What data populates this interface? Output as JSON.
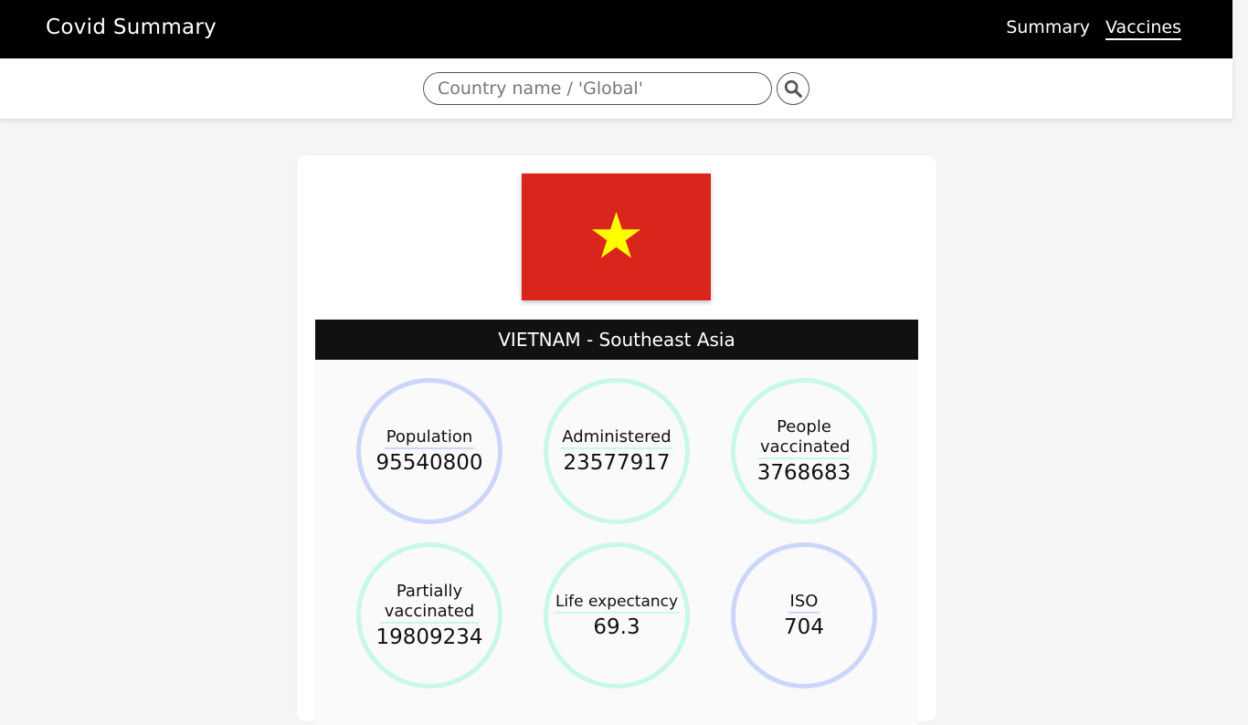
{
  "header": {
    "brand": "Covid Summary",
    "nav": [
      {
        "label": "Summary",
        "active": false
      },
      {
        "label": "Vaccines",
        "active": true
      }
    ]
  },
  "search": {
    "placeholder": "Country name / 'Global'",
    "value": "",
    "button_icon": "search-icon"
  },
  "country": {
    "title": "VIETNAM - Southeast Asia",
    "flag_colors": {
      "background": "#da251d",
      "star": "#ffff00"
    }
  },
  "colors": {
    "blue_ring": "#ccd6fa",
    "green_ring": "#c8f8e6"
  },
  "stats": [
    {
      "label": "Population",
      "value": "95540800",
      "ring": "blue"
    },
    {
      "label": "Administered",
      "value": "23577917",
      "ring": "green"
    },
    {
      "label": "People vaccinated",
      "value": "3768683",
      "ring": "green"
    },
    {
      "label": "Partially vaccinated",
      "value": "19809234",
      "ring": "green"
    },
    {
      "label": "Life expectancy",
      "value": "69.3",
      "ring": "green"
    },
    {
      "label": "ISO",
      "value": "704",
      "ring": "blue"
    }
  ]
}
